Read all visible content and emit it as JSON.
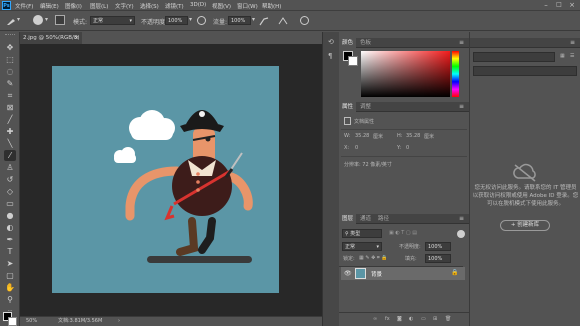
{
  "app": {
    "logo": "Ps"
  },
  "menu": [
    "文件(F)",
    "编辑(E)",
    "图像(I)",
    "图层(L)",
    "文字(Y)",
    "选择(S)",
    "滤镜(T)",
    "3D(D)",
    "视图(V)",
    "窗口(W)",
    "帮助(H)"
  ],
  "options": {
    "mode_label": "模式:",
    "mode_value": "正常",
    "opacity_label": "不透明度:",
    "opacity_value": "100%",
    "flow_label": "流量:",
    "flow_value": "100%"
  },
  "document": {
    "tab_title": "2.jpg @ 50%(RGB/8)",
    "close": "×"
  },
  "status": {
    "zoom": "50%",
    "doc_info": "文档:3.81M/3.56M",
    "arrow": "›"
  },
  "color_panel": {
    "tabs": [
      "颜色",
      "色板"
    ]
  },
  "properties_panel": {
    "tabs": [
      "属性",
      "调整"
    ],
    "doc_props": "文档属性",
    "w_label": "W:",
    "w_value": "35.28",
    "w_unit": "厘米",
    "h_label": "H:",
    "h_value": "35.28",
    "h_unit": "厘米",
    "x_label": "X:",
    "x_value": "0",
    "y_label": "Y:",
    "y_value": "0",
    "resolution": "分辨率: 72 像素/英寸"
  },
  "layers_panel": {
    "tabs": [
      "图层",
      "通道",
      "路径"
    ],
    "kind": "类型",
    "blend": "正常",
    "opacity_label": "不透明度:",
    "opacity_value": "100%",
    "lock_label": "锁定:",
    "fill_label": "填充:",
    "fill_value": "100%",
    "layers": [
      {
        "name": "背景"
      }
    ]
  },
  "libraries": {
    "message": "您无权访问此服务。请联系您的 IT 管理员以获取访问权限或使用 Adobe ID 登录。您可以在脱机模式下使用此服务。",
    "button": "+ 创建新库"
  },
  "colors": {
    "artboard": "#5b96a6",
    "canvas_bg": "#282828",
    "panel": "#535353",
    "accent": "#31a8ff"
  }
}
